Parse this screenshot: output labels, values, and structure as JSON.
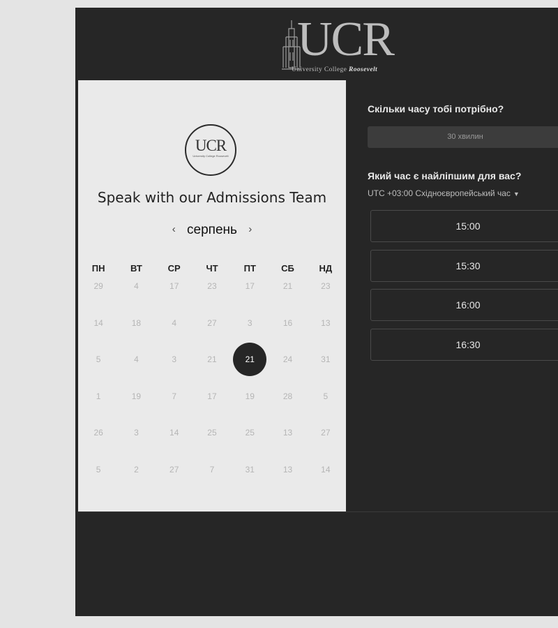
{
  "header": {
    "logo_text": "UCR",
    "logo_subtitle_pre": "University College",
    "logo_subtitle_name": "Roosevelt"
  },
  "left_panel": {
    "small_logo_text": "UCR",
    "small_logo_subtitle": "University College Roosevelt",
    "title": "Speak with our Admissions Team",
    "month": "серпень",
    "prev_icon": "‹",
    "next_icon": "›",
    "weekdays": [
      "ПН",
      "ВТ",
      "СР",
      "ЧТ",
      "ПТ",
      "СБ",
      "НД"
    ],
    "weeks": [
      [
        "29",
        "4",
        "17",
        "23",
        "17",
        "21",
        "23"
      ],
      [
        "14",
        "18",
        "4",
        "27",
        "3",
        "16",
        "13"
      ],
      [
        "5",
        "4",
        "3",
        "21",
        "21",
        "24",
        "31"
      ],
      [
        "1",
        "19",
        "7",
        "17",
        "19",
        "28",
        "5"
      ],
      [
        "26",
        "3",
        "14",
        "25",
        "25",
        "13",
        "27"
      ],
      [
        "5",
        "2",
        "27",
        "7",
        "31",
        "13",
        "14"
      ]
    ],
    "selected_day": "21"
  },
  "right_panel": {
    "duration_question": "Скільки часу тобі потрібно?",
    "duration_value": "30 хвилин",
    "time_question": "Який час є найліпшим для вас?",
    "timezone": "UTC +03:00 Східноєвропейський час",
    "timezone_icon": "caret-down-icon",
    "slots": [
      "15:00",
      "15:30",
      "16:00",
      "16:30"
    ]
  },
  "colors": {
    "page_bg": "#e4e4e4",
    "dark_bg": "#262626",
    "light_panel": "#eaeaea",
    "selected_day_bg": "#262626"
  }
}
